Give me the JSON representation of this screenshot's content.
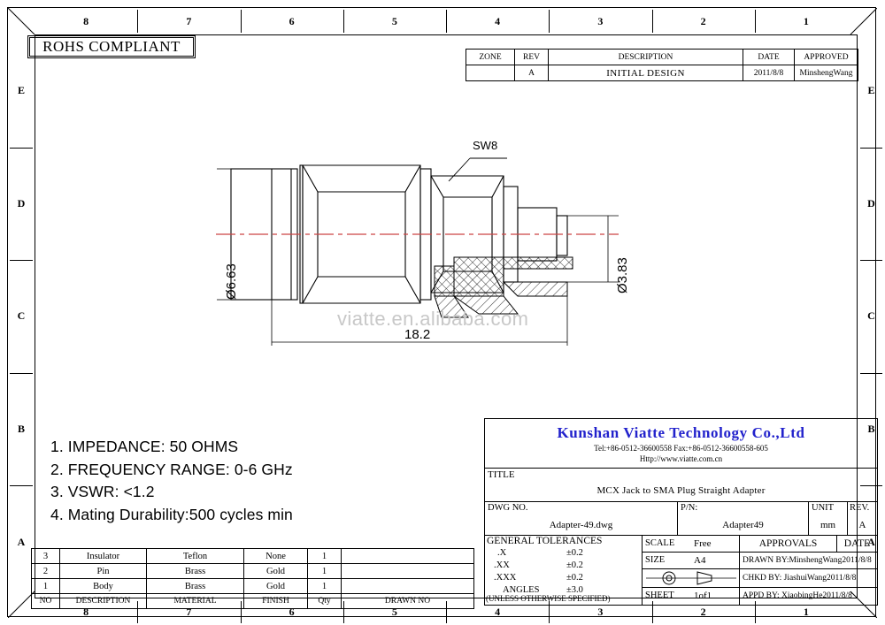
{
  "frame": {
    "columns_top": [
      "8",
      "7",
      "6",
      "5",
      "4",
      "3",
      "2",
      "1"
    ],
    "columns_bottom": [
      "8",
      "7",
      "6",
      "5",
      "4",
      "3",
      "2",
      "1"
    ],
    "rows_left": [
      "E",
      "D",
      "C",
      "B",
      "A"
    ],
    "rows_right": [
      "E",
      "D",
      "C",
      "B",
      "A"
    ]
  },
  "rohs": {
    "label": "ROHS COMPLIANT"
  },
  "revision": {
    "headers": [
      "ZONE",
      "REV",
      "DESCRIPTION",
      "DATE",
      "APPROVED"
    ],
    "rows": [
      {
        "zone": "",
        "rev": "A",
        "description": "INITIAL DESIGN",
        "date": "2011/8/8",
        "approved": "MinshengWang"
      }
    ]
  },
  "notes": [
    "1. IMPEDANCE: 50 OHMS",
    "2. FREQUENCY RANGE: 0-6 GHz",
    "3. VSWR: <1.2",
    "4. Mating Durability:500 cycles min"
  ],
  "bom": {
    "headers": [
      "NO",
      "DESCRIPTION",
      "MATERIAL",
      "FINISH",
      "Qty",
      "DRAWN NO"
    ],
    "rows": [
      {
        "no": "3",
        "description": "Insulator",
        "material": "Teflon",
        "finish": "None",
        "qty": "1",
        "drawn_no": ""
      },
      {
        "no": "2",
        "description": "Pin",
        "material": "Brass",
        "finish": "Gold",
        "qty": "1",
        "drawn_no": ""
      },
      {
        "no": "1",
        "description": "Body",
        "material": "Brass",
        "finish": "Gold",
        "qty": "1",
        "drawn_no": ""
      }
    ]
  },
  "title_block": {
    "company_name": "Kunshan Viatte Technology Co.,Ltd",
    "company_color": "#2222cc",
    "tel_fax": "Tel:+86-0512-36600558    Fax:+86-0512-36600558-605",
    "website": "Http://www.viatte.com.cn",
    "title_label": "TITLE",
    "title_value": "MCX Jack to SMA Plug Straight Adapter",
    "dwg_no_label": "DWG NO.",
    "dwg_no_value": "Adapter-49.dwg",
    "pn_label": "P/N:",
    "pn_value": "Adapter49",
    "unit_label": "UNIT",
    "unit_value": "mm",
    "rev_label": "REV.",
    "rev_value": "A",
    "tolerances_title": "GENERAL  TOLERANCES",
    "tolerances": [
      {
        "name": ".X",
        "value": "±0.2"
      },
      {
        "name": ".XX",
        "value": "±0.2"
      },
      {
        "name": ".XXX",
        "value": "±0.2"
      },
      {
        "name": "ANGLES",
        "value": "±3.0"
      }
    ],
    "tolerances_footer": "(UNLESS OTHERWISE SPECIFIED)",
    "scale_label": "SCALE",
    "scale_value": "Free",
    "size_label": "SIZE",
    "size_value": "A4",
    "sheet_label": "SHEET",
    "sheet_value": "1of1",
    "projection_symbol": "first-angle-projection-icon",
    "approvals_label": "APPROVALS",
    "date_label": "DATE",
    "drawn_by": "DRAWN BY:MinshengWang2011/8/8",
    "chkd_by": "CHKD BY:  JiashuiWang2011/8/8",
    "appd_by": "APPD BY:  XiaobingHe2011/8/8"
  },
  "drawing": {
    "watermark": "viatte.en.alibaba.com",
    "dim_diameter_left": "Ø6.63",
    "dim_diameter_right": "Ø3.83",
    "dim_length": "18.2",
    "callout_sw8": "SW8",
    "centerline_color": "#cc4444"
  }
}
